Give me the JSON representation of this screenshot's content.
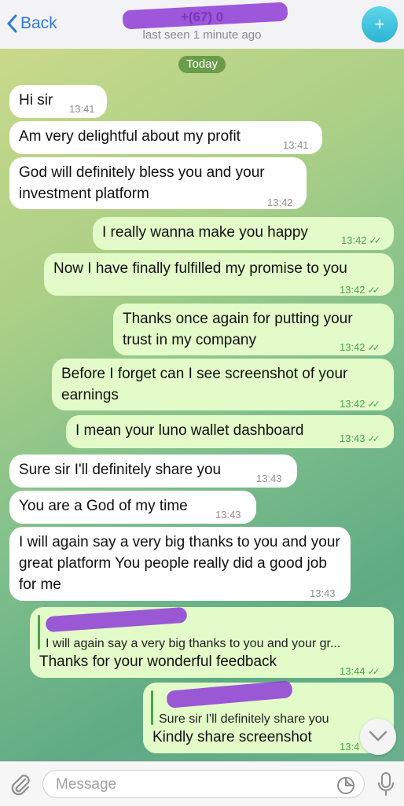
{
  "header": {
    "back_label": "Back",
    "title": "+(67) 0",
    "subtitle": "last seen 1 minute ago"
  },
  "date_chip": "Today",
  "messages": [
    {
      "dir": "in",
      "text": "Hi sir",
      "time": "13:41"
    },
    {
      "dir": "in",
      "text": "Am very delightful about my profit",
      "time": "13:41"
    },
    {
      "dir": "in",
      "text": "God will definitely bless you and your investment platform",
      "time": "13:42"
    },
    {
      "dir": "out",
      "text": "I really wanna make you happy",
      "time": "13:42"
    },
    {
      "dir": "out",
      "text": "Now I have finally fulfilled my promise to you",
      "time": "13:42"
    },
    {
      "dir": "out",
      "text": "Thanks once again for putting your trust in my company",
      "time": "13:42"
    },
    {
      "dir": "out",
      "text": "Before I forget can I see screenshot of your earnings",
      "time": "13:42"
    },
    {
      "dir": "out",
      "text": "I mean your luno wallet dashboard",
      "time": "13:43"
    },
    {
      "dir": "in",
      "text": "Sure sir I'll definitely share you",
      "time": "13:43"
    },
    {
      "dir": "in",
      "text": "You are a God of my time",
      "time": "13:43"
    },
    {
      "dir": "in",
      "text": "I will again say a very big thanks to you and your great platform You people really did a good job for me",
      "time": "13:43"
    },
    {
      "dir": "out",
      "reply_to": "I will again say a very big thanks to you and your gr...",
      "text": "Thanks for your wonderful feedback",
      "time": "13:44"
    },
    {
      "dir": "out",
      "reply_to": "Sure sir I'll definitely share you",
      "text": "Kindly share screenshot",
      "time": "13:4"
    }
  ],
  "input": {
    "placeholder": "Message"
  },
  "icons": {
    "back": "chevron-left-icon",
    "attach": "paperclip-icon",
    "sticker": "sticker-icon",
    "mic": "microphone-icon",
    "scroll": "chevron-down-icon",
    "read": "double-check-icon"
  },
  "colors": {
    "incoming_bubble": "#ffffff",
    "outgoing_bubble": "#e2fbc8",
    "accent": "#2f7bd9",
    "check": "#4aa44a"
  }
}
